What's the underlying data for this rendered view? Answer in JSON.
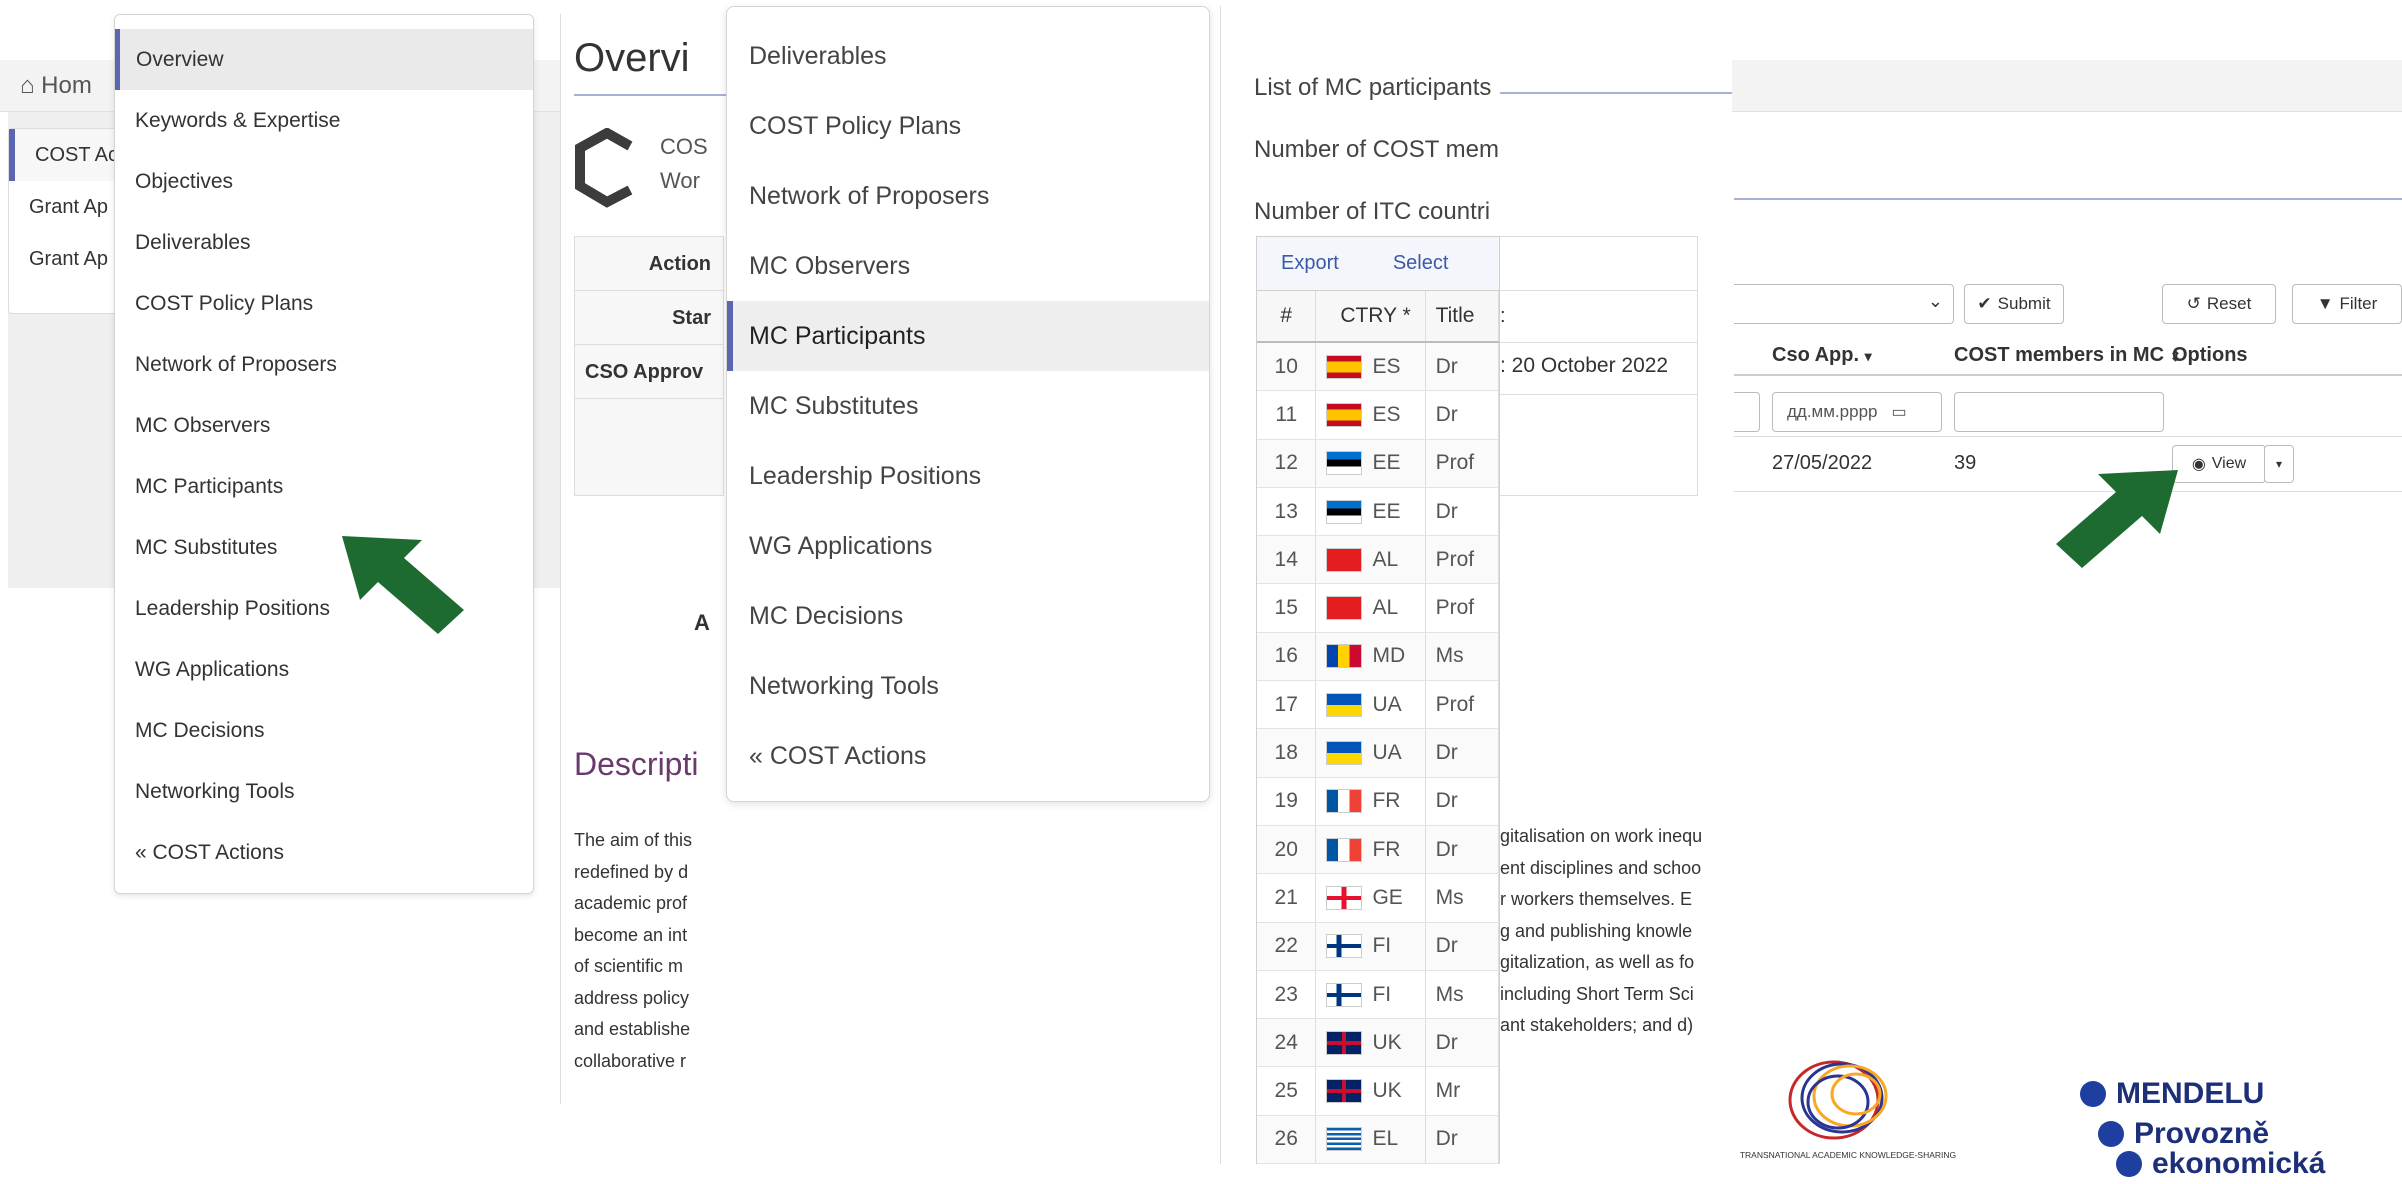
{
  "background": {
    "home_label": "Hom",
    "left_items": [
      {
        "label": "COST Ac",
        "active": true
      },
      {
        "label": "Grant Ap",
        "active": false
      },
      {
        "label": "Grant Ap",
        "active": false
      }
    ]
  },
  "right_table": {
    "submit_label": "Submit",
    "reset_label": "Reset",
    "filter_label": "Filter",
    "columns": [
      "Cso App.",
      "COST members in MC",
      "Options"
    ],
    "date_placeholder": "дд.мм.рррр",
    "row": {
      "cso_app": "27/05/2022",
      "members": "39",
      "view_label": "View"
    }
  },
  "panel1": {
    "items": [
      {
        "label": "Overview",
        "active": true
      },
      {
        "label": "Keywords & Expertise",
        "active": false
      },
      {
        "label": "Objectives",
        "active": false
      },
      {
        "label": "Deliverables",
        "active": false
      },
      {
        "label": "COST Policy Plans",
        "active": false
      },
      {
        "label": "Network of Proposers",
        "active": false
      },
      {
        "label": "MC Observers",
        "active": false
      },
      {
        "label": "MC Participants",
        "active": false
      },
      {
        "label": "MC Substitutes",
        "active": false
      },
      {
        "label": "Leadership Positions",
        "active": false
      },
      {
        "label": "WG Applications",
        "active": false
      },
      {
        "label": "MC Decisions",
        "active": false
      },
      {
        "label": "Networking Tools",
        "active": false
      },
      {
        "label": "« COST Actions",
        "active": false
      }
    ]
  },
  "page2": {
    "title": "Overvi",
    "logo_line1": "COS",
    "logo_line2": "Wor",
    "info_rows": [
      "Action",
      "Star",
      "CSO Approv",
      ""
    ],
    "letter_a": "A",
    "desc_title": "Descripti",
    "desc_lines": [
      "The aim of this",
      "redefined by d",
      "academic prof",
      "become an int",
      "of scientific m",
      "address policy",
      "and establishe",
      "collaborative r"
    ]
  },
  "panel3": {
    "items": [
      {
        "label": "Deliverables",
        "active": false
      },
      {
        "label": "COST Policy Plans",
        "active": false
      },
      {
        "label": "Network of Proposers",
        "active": false
      },
      {
        "label": "MC Observers",
        "active": false
      },
      {
        "label": "MC Participants",
        "active": true
      },
      {
        "label": "MC Substitutes",
        "active": false
      },
      {
        "label": "Leadership Positions",
        "active": false
      },
      {
        "label": "WG Applications",
        "active": false
      },
      {
        "label": "MC Decisions",
        "active": false
      },
      {
        "label": "Networking Tools",
        "active": false
      },
      {
        "label": "« COST Actions",
        "active": false
      }
    ]
  },
  "panel4": {
    "label_list": "List of MC participants",
    "label_cost": "Number of COST mem",
    "label_itc": "Number of ITC countri",
    "toolbar": {
      "export": "Export",
      "select": "Select"
    },
    "headers": {
      "num": "#",
      "ctry": "CTRY *",
      "title": "Title"
    },
    "rows": [
      {
        "num": "10",
        "ctry": "ES",
        "title": "Dr",
        "flag": "es"
      },
      {
        "num": "11",
        "ctry": "ES",
        "title": "Dr",
        "flag": "es"
      },
      {
        "num": "12",
        "ctry": "EE",
        "title": "Prof",
        "flag": "ee"
      },
      {
        "num": "13",
        "ctry": "EE",
        "title": "Dr",
        "flag": "ee"
      },
      {
        "num": "14",
        "ctry": "AL",
        "title": "Prof",
        "flag": "al"
      },
      {
        "num": "15",
        "ctry": "AL",
        "title": "Prof",
        "flag": "al"
      },
      {
        "num": "16",
        "ctry": "MD",
        "title": "Ms",
        "flag": "md"
      },
      {
        "num": "17",
        "ctry": "UA",
        "title": "Prof",
        "flag": "ua"
      },
      {
        "num": "18",
        "ctry": "UA",
        "title": "Dr",
        "flag": "ua"
      },
      {
        "num": "19",
        "ctry": "FR",
        "title": "Dr",
        "flag": "fr"
      },
      {
        "num": "20",
        "ctry": "FR",
        "title": "Dr",
        "flag": "fr"
      },
      {
        "num": "21",
        "ctry": "GE",
        "title": "Ms",
        "flag": "ge"
      },
      {
        "num": "22",
        "ctry": "FI",
        "title": "Dr",
        "flag": "fi"
      },
      {
        "num": "23",
        "ctry": "FI",
        "title": "Ms",
        "flag": "fi"
      },
      {
        "num": "24",
        "ctry": "UK",
        "title": "Dr",
        "flag": "uk"
      },
      {
        "num": "25",
        "ctry": "UK",
        "title": "Mr",
        "flag": "uk"
      },
      {
        "num": "26",
        "ctry": "EL",
        "title": "Dr",
        "flag": "el"
      }
    ],
    "extra_colon": ":",
    "extra_date": ": 20 October 2022",
    "text_fragments": [
      "gitalisation on work inequ",
      "ent disciplines and schoo",
      "r workers themselves. E",
      "g and publishing knowle",
      "gitalization, as well as fo",
      "including Short Term Sci",
      "ant stakeholders; and d)"
    ]
  },
  "logos": {
    "tak_caption": "TRANSNATIONAL ACADEMIC KNOWLEDGE-SHARING",
    "mendelu_lines": [
      "MENDELU",
      "Provozně",
      "ekonomická"
    ]
  },
  "colors": {
    "accent": "#5a67b0",
    "arrow_green": "#1d6b30",
    "description_title": "#6a3a6c",
    "link_blue": "#3a5aa8",
    "mendelu_blue": "#1e3fa0"
  }
}
